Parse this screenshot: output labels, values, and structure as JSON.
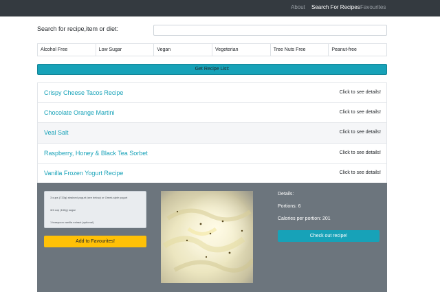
{
  "nav": {
    "links": [
      "About",
      "Search For Recipes",
      "Favourites"
    ],
    "active_index": 1
  },
  "search": {
    "label": "Search for recipe,item or diet:",
    "value": "",
    "placeholder": ""
  },
  "filters": [
    "Alcohol Free",
    "Low Sugar",
    "Vegan",
    "Vegeterian",
    "Tree Nuts Free",
    "Peanut-free"
  ],
  "get_list_button": "Get Recipe List:",
  "recipes": [
    {
      "title": "Crispy Cheese Tacos Recipe",
      "action": "Click to see details!"
    },
    {
      "title": "Chocolate Orange Martini",
      "action": "Click to see details!"
    },
    {
      "title": "Veal Salt",
      "action": "Click to see details!"
    },
    {
      "title": "Raspberry, Honey & Black Tea Sorbet",
      "action": "Click to see details!"
    },
    {
      "title": "Vanilla Frozen Yogurt Recipe",
      "action": "Click to see details!"
    }
  ],
  "hovered_recipe_index": 2,
  "detail": {
    "ingredients": [
      "3 cups (720g) strained yogurt (see below) or Greek-style yogurt",
      "3/4 cup (150g) sugar",
      "1 teaspoon vanilla extract (optional)"
    ],
    "add_favourites_button": "Add to Favourites!",
    "details_heading": "Details:",
    "portions": "Portions: 6",
    "calories": "Calories per portion: 201",
    "check_out_button": "Check out recipe!"
  },
  "colors": {
    "navbar": "#343a40",
    "accent": "#17a2b8",
    "favourite": "#ffc107",
    "panel": "#6c757d"
  }
}
